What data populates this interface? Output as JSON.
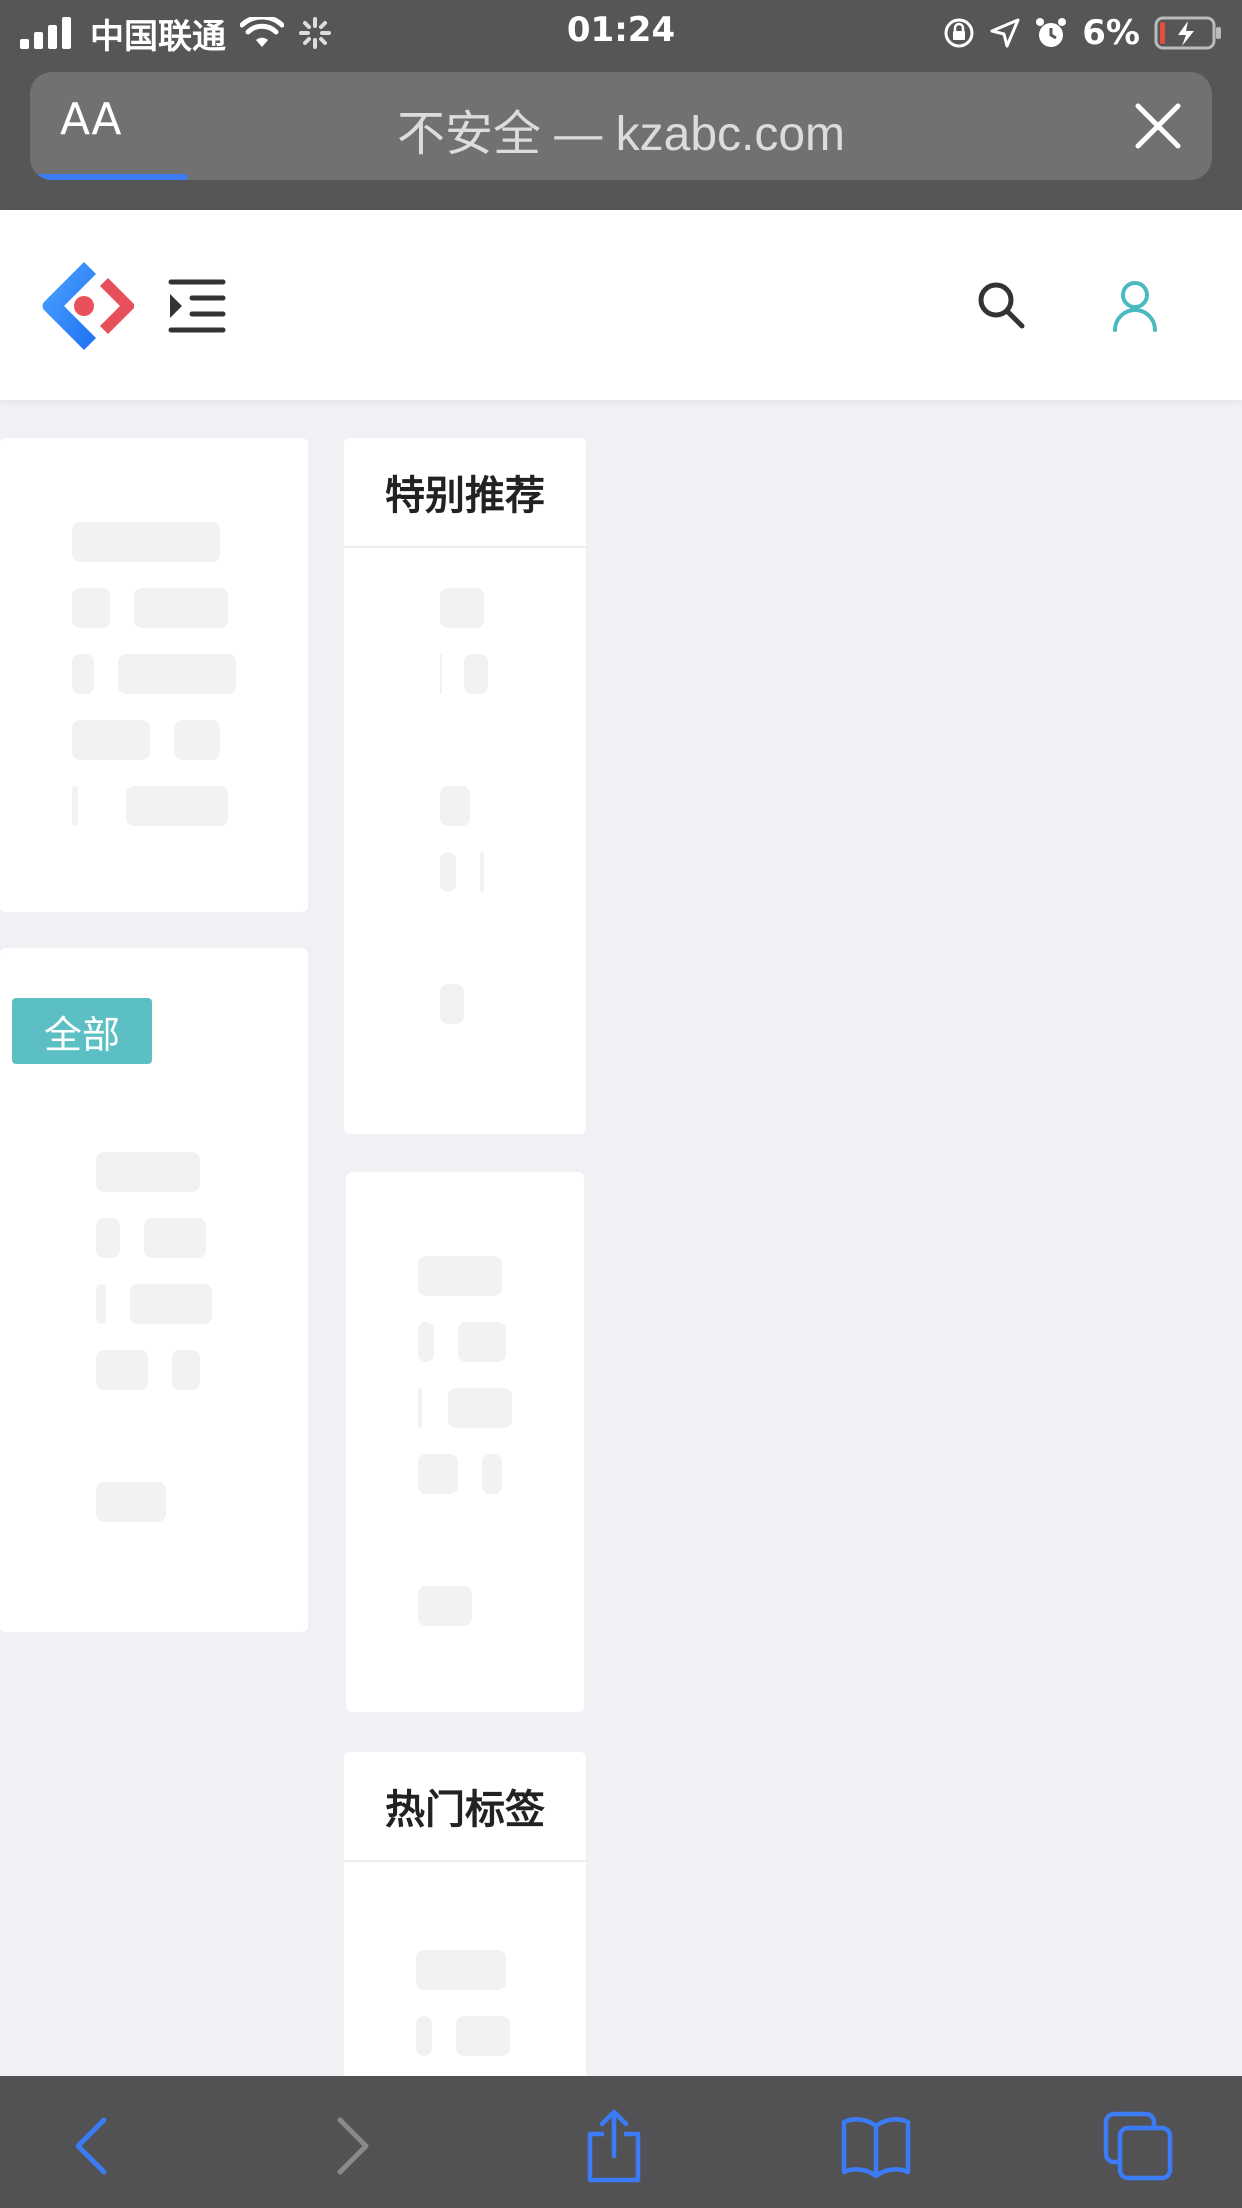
{
  "status_bar": {
    "carrier": "中国联通",
    "time": "01:24",
    "battery": "6%"
  },
  "url_bar": {
    "text_size_label": "AA",
    "url": "不安全 — kzabc.com"
  },
  "cards": {
    "recommend_title": "特别推荐",
    "hot_tags_title": "热门标签",
    "all_tag": "全部"
  },
  "colors": {
    "accent_teal": "#5bbfc3",
    "chrome_dark": "#555658",
    "link_blue": "#3b7bf6"
  },
  "icons": {
    "menu": "menu-indent-icon",
    "search": "search-icon",
    "user": "user-icon",
    "back": "chevron-left-icon",
    "forward": "chevron-right-icon",
    "share": "share-icon",
    "bookmarks": "book-icon",
    "tabs": "tabs-icon"
  }
}
